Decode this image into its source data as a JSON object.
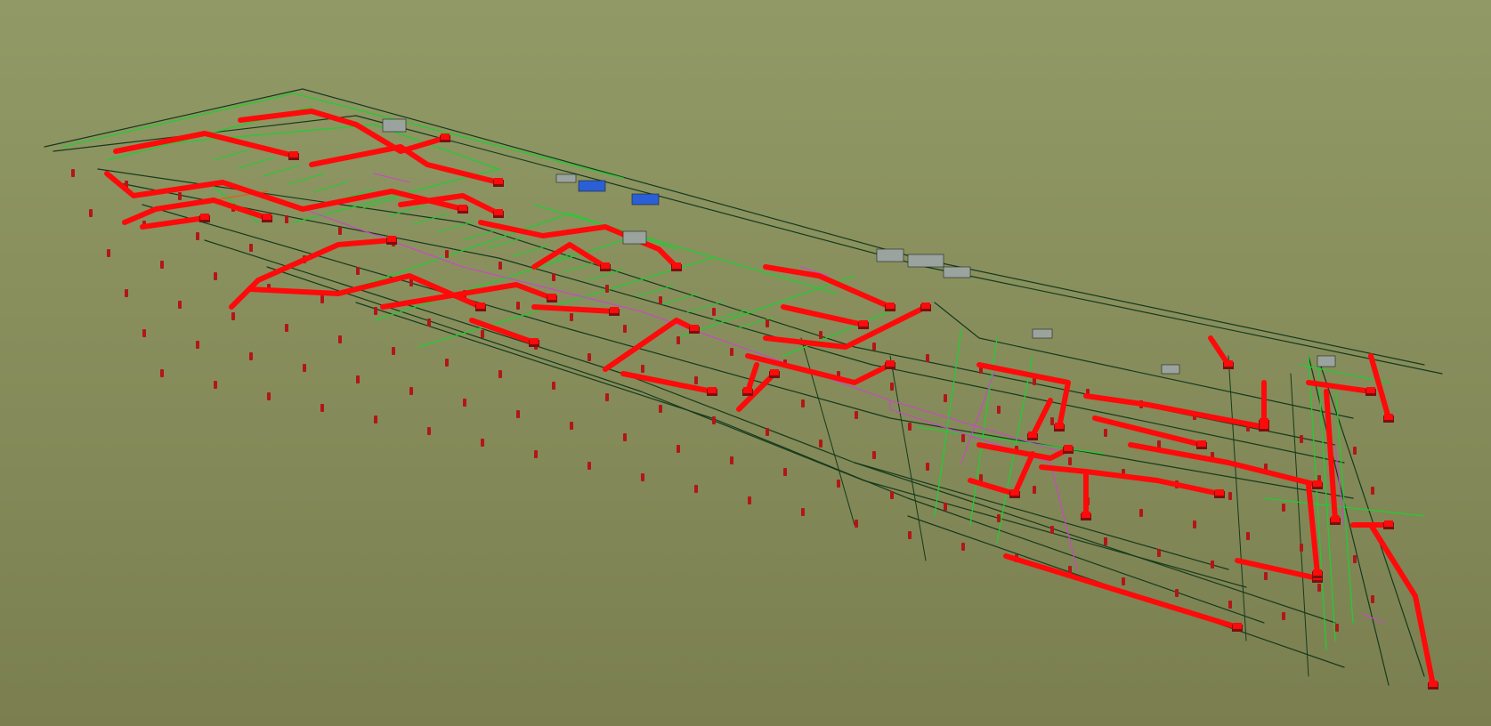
{
  "viewport": {
    "background_top": "#919a66",
    "background_bottom": "#7b7f50",
    "colors": {
      "duct": "#ff0a0a",
      "duct_shadow": "#7a1010",
      "pipe_green": "#22cc33",
      "pipe_dark": "#153a1c",
      "pipe_magenta": "#cc44cc",
      "pipe_orange": "#cc6a20",
      "equipment_blue": "#2a5fd8",
      "equipment_grey": "#9aa39e",
      "hanger": "#b31616"
    }
  }
}
